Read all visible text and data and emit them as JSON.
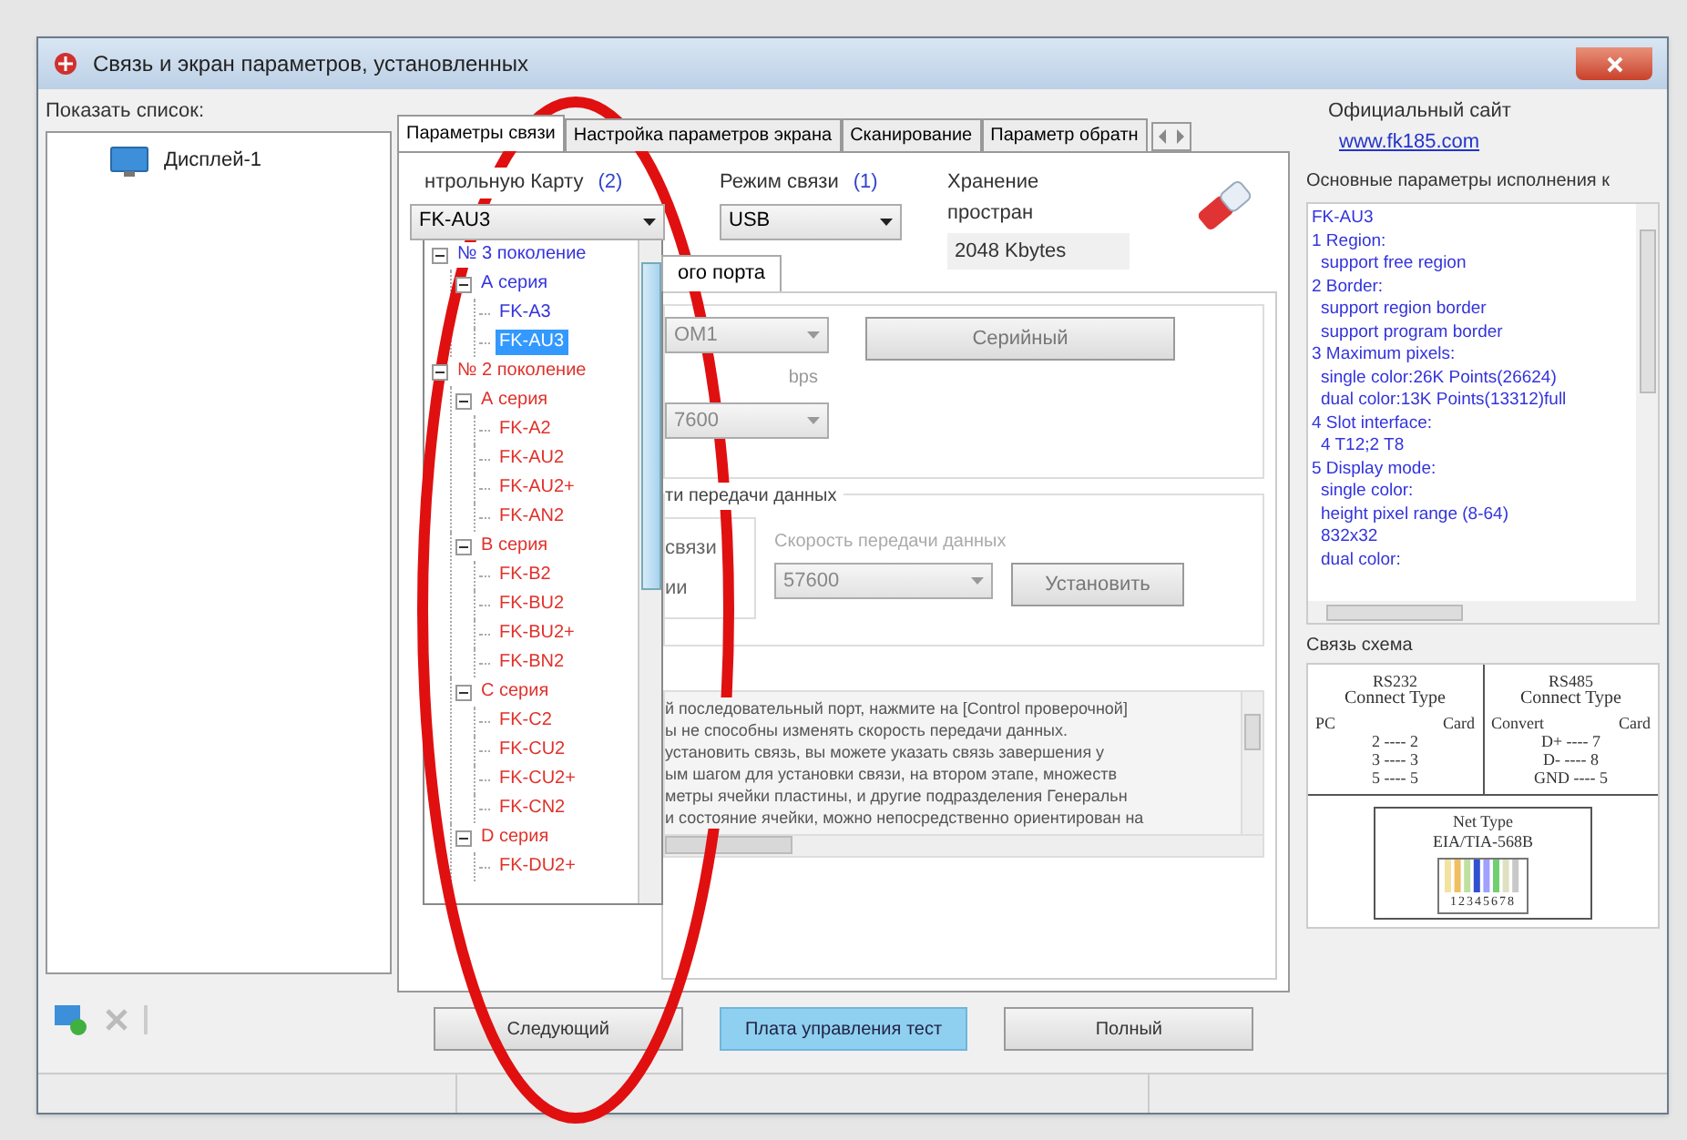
{
  "window": {
    "title": "Связь и экран параметров, установленных"
  },
  "device_list": {
    "label": "Показать список:",
    "items": [
      {
        "label": "Дисплей-1",
        "selected": false
      }
    ]
  },
  "tabs": [
    {
      "label": "Параметры связи",
      "selected": true
    },
    {
      "label": "Настройка параметров экрана",
      "selected": false
    },
    {
      "label": "Сканирование",
      "selected": false
    },
    {
      "label": "Параметр обратн",
      "selected": false
    }
  ],
  "controller": {
    "label": "нтрольную Карту",
    "hint": "(2)",
    "value": "FK-AU3"
  },
  "mode": {
    "label": "Режим связи",
    "hint": "(1)",
    "value": "USB"
  },
  "storage": {
    "label": "Хранение простран",
    "value": "2048 Kbytes"
  },
  "controller_dropdown": {
    "expanded": true,
    "items": [
      {
        "label": "№ 3 поколение",
        "color": "#3333dd",
        "children": [
          {
            "label": "А серия",
            "children": [
              {
                "label": "FK-A3",
                "selected": false
              },
              {
                "label": "FK-AU3",
                "selected": true
              }
            ]
          }
        ]
      },
      {
        "label": "№ 2 поколение",
        "color": "#e0302a",
        "children": [
          {
            "label": "А серия",
            "children": [
              {
                "label": "FK-A2",
                "selected": false
              },
              {
                "label": "FK-AU2",
                "selected": false
              },
              {
                "label": "FK-AU2+",
                "selected": false
              },
              {
                "label": "FK-AN2",
                "selected": false
              }
            ]
          },
          {
            "label": "В серия",
            "children": [
              {
                "label": "FK-B2",
                "selected": false
              },
              {
                "label": "FK-BU2",
                "selected": false
              },
              {
                "label": "FK-BU2+",
                "selected": false
              },
              {
                "label": "FK-BN2",
                "selected": false
              }
            ]
          },
          {
            "label": "С серия",
            "children": [
              {
                "label": "FK-C2",
                "selected": false
              },
              {
                "label": "FK-CU2",
                "selected": false
              },
              {
                "label": "FK-CU2+",
                "selected": false
              },
              {
                "label": "FK-CN2",
                "selected": false
              }
            ]
          },
          {
            "label": "D серия",
            "children": [
              {
                "label": "FK-DU2+",
                "selected": false
              }
            ]
          }
        ]
      }
    ]
  },
  "inner_tab": "ого порта",
  "port_group": {
    "port_value": "OM1",
    "baud_label": "bps",
    "baud_value": "7600",
    "button": "Серийный"
  },
  "transfer_group": {
    "legend": "ти передачи данных",
    "options": [
      "связи",
      "ии"
    ],
    "speed_label": "Скорость передачи данных",
    "speed_value": "57600",
    "button": "Установить"
  },
  "help_text": [
    "й последовательный порт, нажмите на [Control проверочной]",
    "ы не способны изменять скорость передачи данных.",
    "установить связь, вы можете указать связь завершения у",
    "ым шагом для установки связи, на втором этапе, множеств",
    "метры ячейки пластины, и другие подразделения Генеральн",
    "и состояние ячейки, можно непосредственно ориентирован на"
  ],
  "buttons": [
    {
      "label": "Следующий",
      "selected": false
    },
    {
      "label": "Плата управления тест",
      "selected": true
    },
    {
      "label": "Полный",
      "selected": false
    }
  ],
  "site": {
    "label": "Официальный сайт",
    "link": "www.fk185.com"
  },
  "params": {
    "title": "Основные параметры исполнения к",
    "lines": [
      {
        "text": "FK-AU3",
        "kind": "head"
      },
      {
        "text": "1 Region:",
        "kind": "head"
      },
      {
        "text": "support free region",
        "kind": "item"
      },
      {
        "text": "2 Border:",
        "kind": "head"
      },
      {
        "text": "support region border",
        "kind": "item"
      },
      {
        "text": "support program border",
        "kind": "item"
      },
      {
        "text": "3 Maximum pixels:",
        "kind": "head"
      },
      {
        "text": "single color:26K Points(26624)",
        "kind": "item"
      },
      {
        "text": "dual color:13K Points(13312)full",
        "kind": "item"
      },
      {
        "text": "4 Slot interface:",
        "kind": "head"
      },
      {
        "text": "4 T12;2 T8",
        "kind": "item"
      },
      {
        "text": "5 Display mode:",
        "kind": "head"
      },
      {
        "text": "single color:",
        "kind": "item"
      },
      {
        "text": "height pixel range (8-64)",
        "kind": "item"
      },
      {
        "text": "832x32",
        "kind": "item"
      },
      {
        "text": "dual color:",
        "kind": "item"
      }
    ]
  },
  "scheme": {
    "title": "Связь схема",
    "rs232": {
      "title": "RS232",
      "subtitle": "Connect Type",
      "headers": [
        "PC",
        "Card"
      ],
      "rows": [
        "2 ---- 2",
        "3 ---- 3",
        "5 ---- 5"
      ]
    },
    "rs485": {
      "title": "RS485",
      "subtitle": "Connect Type",
      "headers": [
        "Convert",
        "Card"
      ],
      "rows": [
        "D+ ---- 7",
        "D- ---- 8",
        "GND ---- 5"
      ]
    },
    "net": {
      "title": "Net Type",
      "standard": "EIA/TIA-568B",
      "pins": "12345678"
    }
  }
}
